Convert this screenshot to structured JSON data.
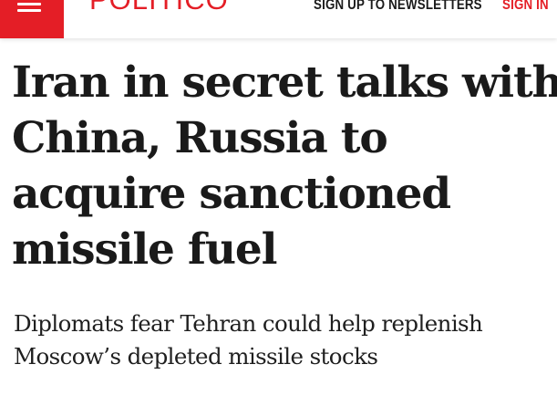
{
  "header": {
    "menu_icon": "hamburger-menu-icon",
    "brand_text": "POLITICO",
    "newsletter_label": "SIGN UP TO NEWSLETTERS",
    "signin_label": "SIGN IN",
    "colors": {
      "brand_red": "#e41e26",
      "text_dark": "#1a1a1a",
      "background": "#ffffff"
    }
  },
  "article": {
    "headline_lines": [
      "Iran in secret talks with",
      "China, Russia to",
      "acquire sanctioned",
      "missile fuel"
    ],
    "dek_lines": [
      "Diplomats fear Tehran could help replenish",
      "Moscow’s depleted missile stocks"
    ]
  }
}
